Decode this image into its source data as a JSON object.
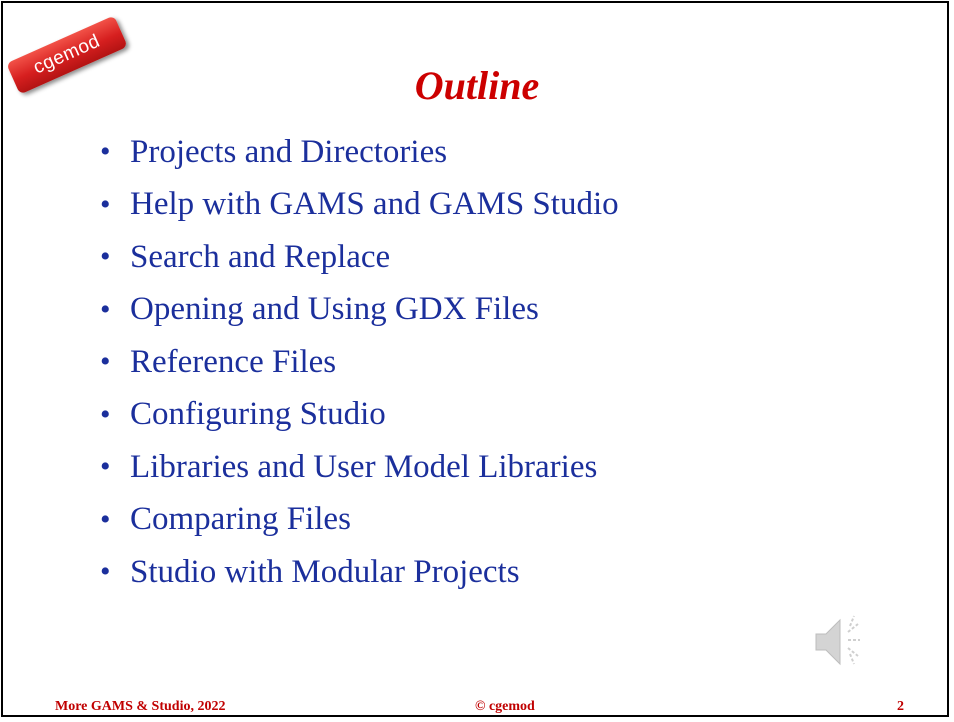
{
  "slide": {
    "logo_text": "cgemod",
    "title": "Outline",
    "bullets": [
      "Projects and Directories",
      "Help with GAMS and GAMS Studio",
      "Search and Replace",
      "Opening and Using GDX Files",
      "Reference Files",
      "Configuring Studio",
      "Libraries and User Model Libraries",
      "Comparing Files",
      "Studio with Modular Projects"
    ],
    "bullet_glyph": "•",
    "audio_icon": "speaker-icon"
  },
  "footer": {
    "left": "More GAMS & Studio, 2022",
    "center": "© cgemod",
    "page_number": "2"
  },
  "colors": {
    "title": "#cc0000",
    "bullet_text": "#1b2f9c",
    "footer": "#c00000",
    "logo_bg": "#d61f1f"
  }
}
